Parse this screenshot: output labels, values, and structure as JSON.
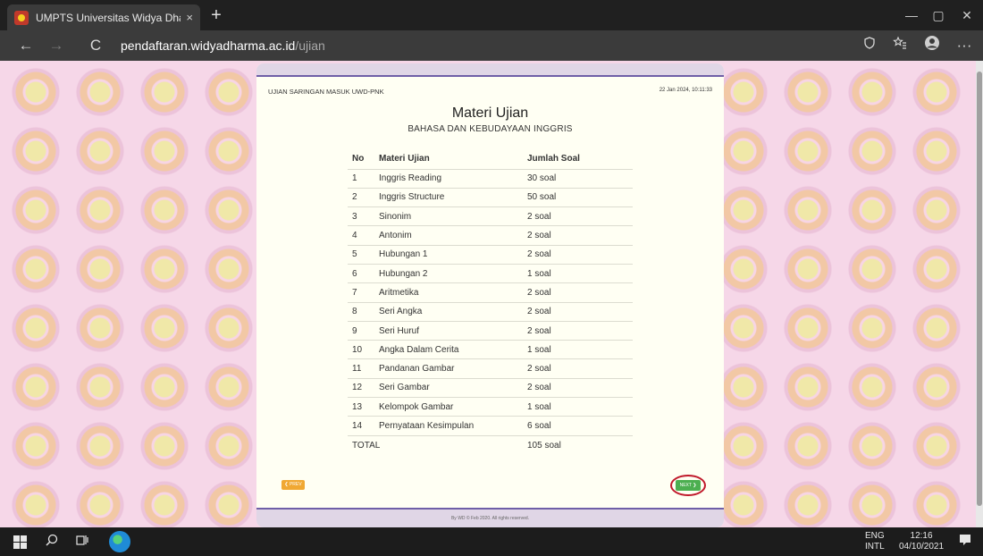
{
  "browser": {
    "tab_title": "UMPTS Universitas Widya Dharm",
    "tab_close": "×",
    "new_tab": "+",
    "url_host": "pendaftaran.widyadharma.ac.id",
    "url_path": "/ujian",
    "nav": {
      "back": "←",
      "forward": "→",
      "refresh": "C"
    },
    "window": {
      "minimize": "—",
      "maximize": "▢",
      "close": "✕"
    },
    "toolbar_icons": [
      "tracking-prevention-icon",
      "favorites-icon",
      "profile-icon",
      "more-icon"
    ],
    "more": "···"
  },
  "page": {
    "header_left": "UJIAN SARINGAN MASUK UWD-PNK",
    "header_right": "22 Jan 2024, 10:11:33",
    "title": "Materi Ujian",
    "subtitle": "BAHASA DAN KEBUDAYAAN INGGRIS",
    "columns": {
      "no": "No",
      "name": "Materi Ujian",
      "count": "Jumlah Soal"
    },
    "rows": [
      {
        "no": "1",
        "name": "Inggris Reading",
        "count": "30 soal"
      },
      {
        "no": "2",
        "name": "Inggris Structure",
        "count": "50 soal"
      },
      {
        "no": "3",
        "name": "Sinonim",
        "count": "2 soal"
      },
      {
        "no": "4",
        "name": "Antonim",
        "count": "2 soal"
      },
      {
        "no": "5",
        "name": "Hubungan 1",
        "count": "2 soal"
      },
      {
        "no": "6",
        "name": "Hubungan 2",
        "count": "1 soal"
      },
      {
        "no": "7",
        "name": "Aritmetika",
        "count": "2 soal"
      },
      {
        "no": "8",
        "name": "Seri Angka",
        "count": "2 soal"
      },
      {
        "no": "9",
        "name": "Seri Huruf",
        "count": "2 soal"
      },
      {
        "no": "10",
        "name": "Angka Dalam Cerita",
        "count": "1 soal"
      },
      {
        "no": "11",
        "name": "Pandanan Gambar",
        "count": "2 soal"
      },
      {
        "no": "12",
        "name": "Seri Gambar",
        "count": "2 soal"
      },
      {
        "no": "13",
        "name": "Kelompok Gambar",
        "count": "1 soal"
      },
      {
        "no": "14",
        "name": "Pernyataan Kesimpulan",
        "count": "6 soal"
      }
    ],
    "total_label": "TOTAL",
    "total_value": "105 soal",
    "prev_label": "❮ PREV",
    "next_label": "NEXT ❯",
    "footer": "By WD © Feb 2020. All rights reserved."
  },
  "taskbar": {
    "lang_top": "ENG",
    "lang_bottom": "INTL",
    "time": "12:16",
    "date": "04/10/2021"
  },
  "colors": {
    "accent_purple": "#6f5fa7",
    "next_green": "#4caf50",
    "prev_orange": "#f0a833",
    "highlight_red": "#c0182a"
  }
}
